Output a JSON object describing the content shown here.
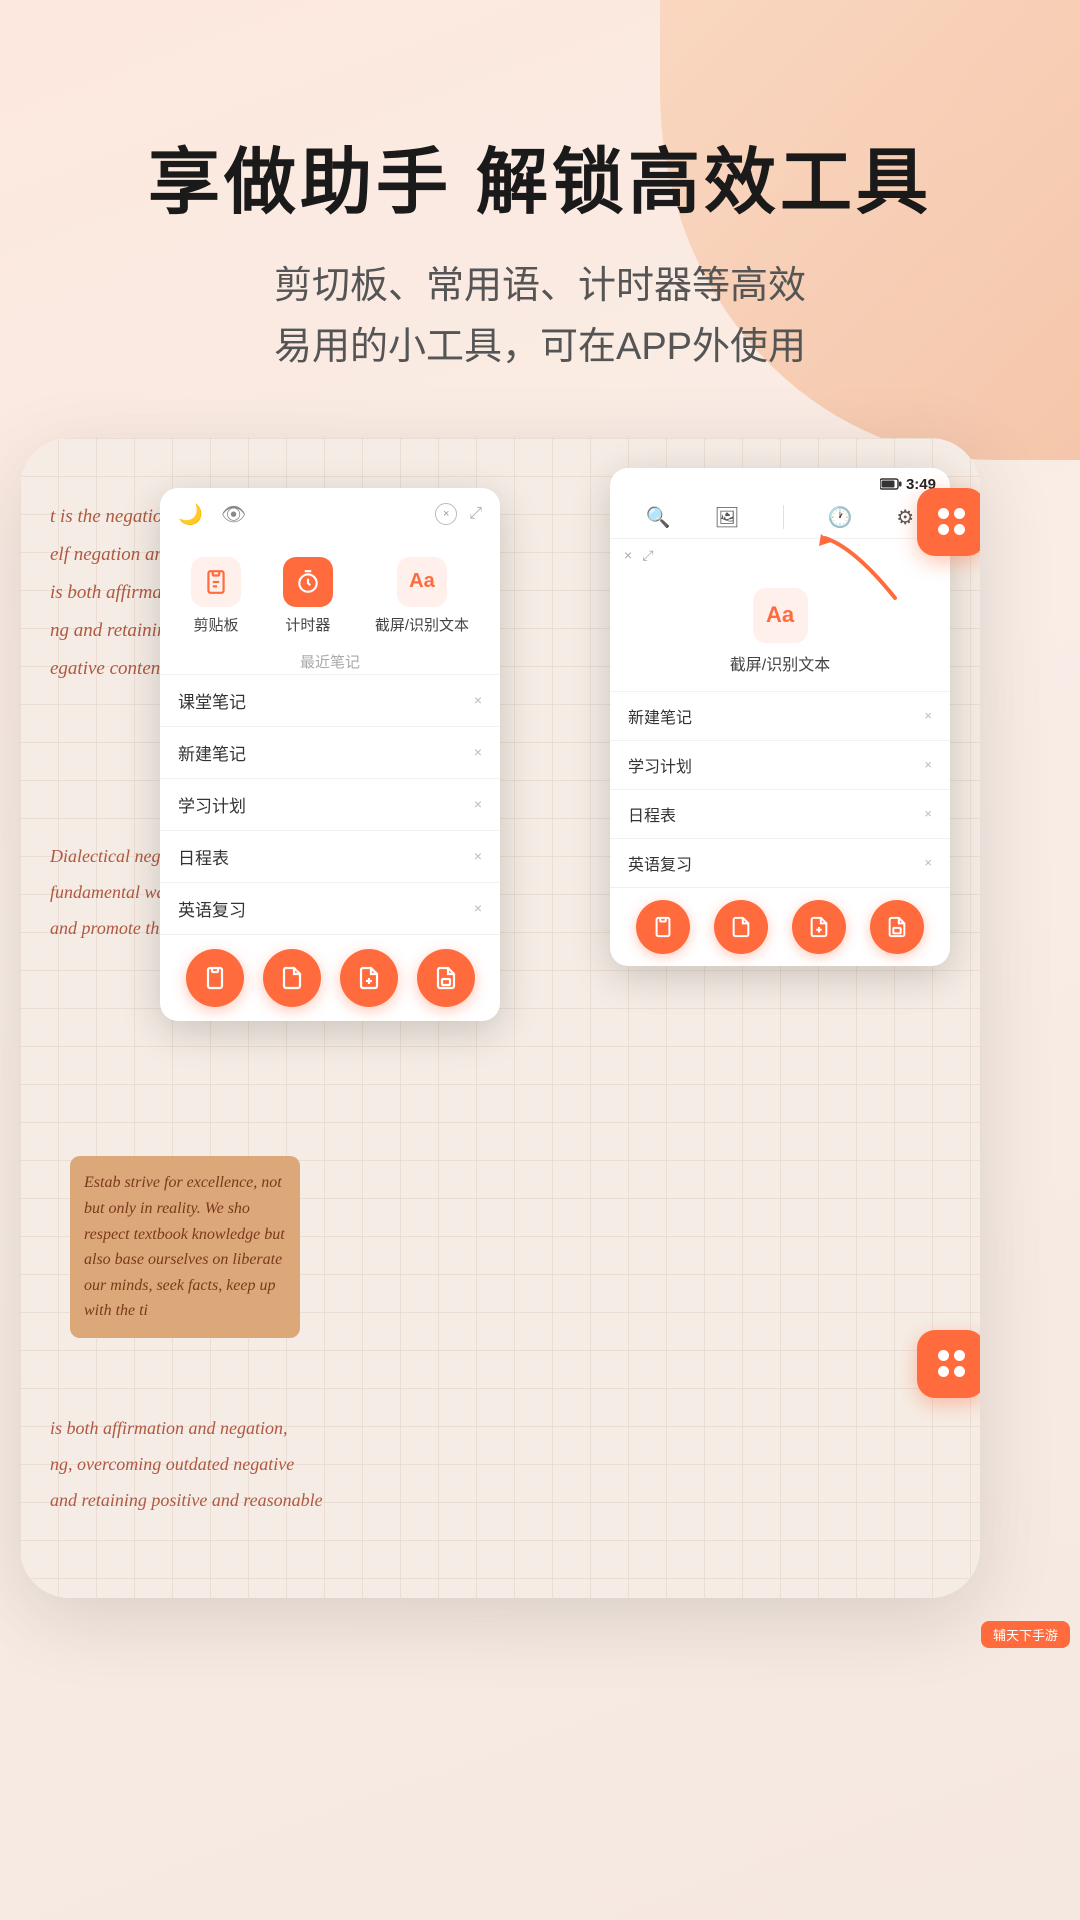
{
  "page": {
    "background_color": "#f5e8e0",
    "hero": {
      "title": "享做助手 解锁高效工具",
      "subtitle_line1": "剪切板、常用语、计时器等高效",
      "subtitle_line2": "易用的小工具，可在APP外使用"
    },
    "left_popup": {
      "topbar": {
        "icon1": "🌙",
        "icon2": "👁",
        "close": "×",
        "expand": "⤢"
      },
      "tabs": [
        {
          "label": "剪贴板",
          "icon": "📋",
          "active": false
        },
        {
          "label": "计时器",
          "icon": "⏰",
          "active": true
        },
        {
          "label": "截屏/识别文本",
          "icon": "Aa",
          "active": false
        }
      ],
      "section_title": "最近笔记",
      "notes": [
        {
          "name": "课堂笔记"
        },
        {
          "name": "新建笔记"
        },
        {
          "name": "学习计划"
        },
        {
          "name": "日程表"
        },
        {
          "name": "英语复习"
        }
      ],
      "action_buttons": [
        "📋",
        "📄",
        "📤",
        "📑"
      ]
    },
    "right_popup": {
      "status_bar": {
        "time": "3:49",
        "battery": "▊"
      },
      "toolbar_icons": [
        "+🔍",
        "🖼",
        "|",
        "🕐",
        "⚙"
      ],
      "mini_bar": {
        "close": "×",
        "expand": "⤢"
      },
      "ocr": {
        "icon": "Aa",
        "label": "截屏/识别文本"
      },
      "notes": [
        {
          "name": "新建笔记"
        },
        {
          "name": "学习计划"
        },
        {
          "name": "日程表"
        },
        {
          "name": "英语复习"
        }
      ],
      "action_buttons": [
        "📋",
        "📄",
        "📤",
        "📑"
      ]
    },
    "fab_top": {
      "label": "app-launcher"
    },
    "fab_bottom": {
      "label": "app-launcher"
    },
    "tablet_content": {
      "script_text": [
        "t is the negation of things",
        "elf negation and self develo",
        "is both affirmation",
        "ng and retaining,",
        "egative content in"
      ],
      "italic_lower": [
        "Dialectical negation is a",
        "fundamental way to achi",
        "and promote the destru"
      ],
      "script_bottom": [
        "is both affirmation and negation,",
        "ng, overcoming outdated negative",
        "and retaining positive and reasonable"
      ],
      "sticky_text": "Estab strive for excellence, not but only in reality. We sho respect textbook knowledge but also base ourselves on liberate our minds, seek facts, keep up with the ti"
    },
    "watermark": {
      "text": "辅天下手游",
      "detail": "辅天下手游"
    }
  }
}
